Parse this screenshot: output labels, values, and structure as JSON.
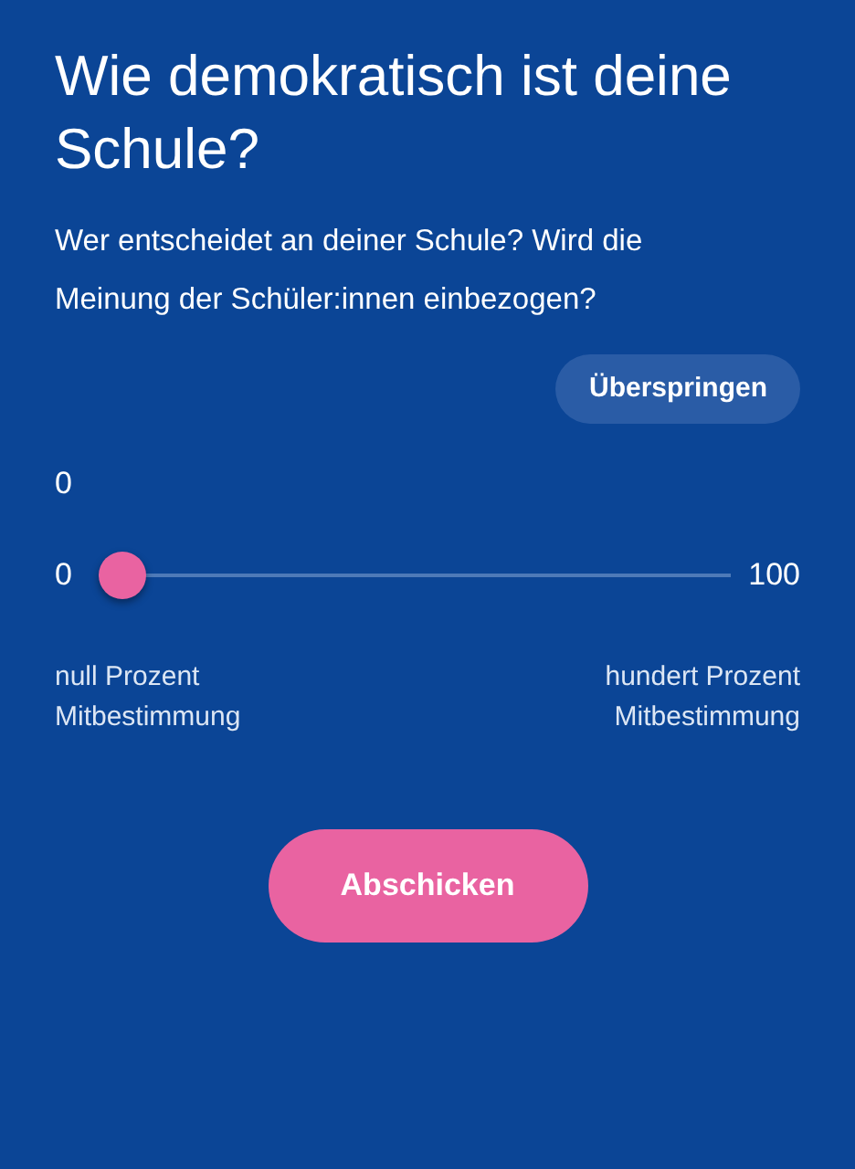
{
  "title": "Wie demokratisch ist deine Schule?",
  "subtitle": "Wer entscheidet an deiner Schule? Wird die Meinung der Schüler:innen einbezogen?",
  "skip_button": "Überspringen",
  "slider": {
    "value": "0",
    "min_label": "0",
    "max_label": "100",
    "level": 0,
    "left_caption": "null Prozent Mitbestimmung",
    "right_caption": "hundert Prozent Mitbestimmung"
  },
  "submit_button": "Abschicken"
}
